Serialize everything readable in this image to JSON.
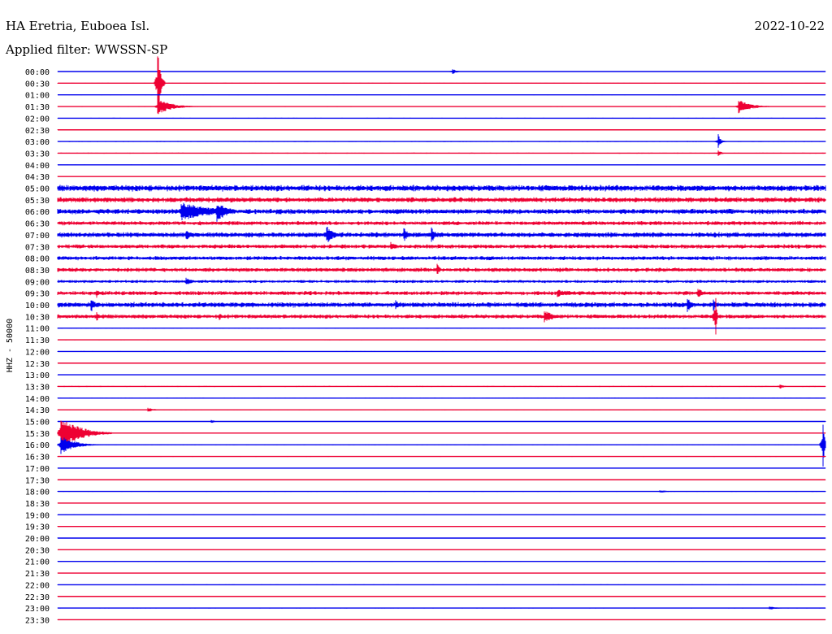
{
  "header": {
    "station": "HA Eretria, Euboea Isl.",
    "date": "2022-10-22",
    "filter_label": "Applied filter: WWSSN-SP"
  },
  "chart_data": {
    "type": "line",
    "title": "HA Eretria, Euboea Isl.",
    "subtitle": "Applied filter: WWSSN-SP",
    "ylabel": "HHZ - 50000",
    "row_labels": [
      "00:00",
      "00:30",
      "01:00",
      "01:30",
      "02:00",
      "02:30",
      "03:00",
      "03:30",
      "04:00",
      "04:30",
      "05:00",
      "05:30",
      "06:00",
      "06:30",
      "07:00",
      "07:30",
      "08:00",
      "08:30",
      "09:00",
      "09:30",
      "10:00",
      "10:30",
      "11:00",
      "11:30",
      "12:00",
      "12:30",
      "13:00",
      "13:30",
      "14:00",
      "14:30",
      "15:00",
      "15:30",
      "16:00",
      "16:30",
      "17:00",
      "17:30",
      "18:00",
      "18:30",
      "19:00",
      "19:30",
      "20:00",
      "20:30",
      "21:00",
      "21:30",
      "22:00",
      "22:30",
      "23:00",
      "23:30"
    ],
    "row_minutes": 30,
    "trace_colors": [
      "#0000ee",
      "#ee0033"
    ],
    "row_noise": [
      0.3,
      0.4,
      0.3,
      0.4,
      0.4,
      0.4,
      0.5,
      0.5,
      0.3,
      0.3,
      3.0,
      2.5,
      2.5,
      2.0,
      2.5,
      2.0,
      2.0,
      2.0,
      1.5,
      2.0,
      2.5,
      2.0,
      0.4,
      0.4,
      0.4,
      0.3,
      0.3,
      0.5,
      0.4,
      0.4,
      0.4,
      0.3,
      0.4,
      0.4,
      0.3,
      0.3,
      0.4,
      0.3,
      0.3,
      0.3,
      0.4,
      0.3,
      0.3,
      0.3,
      0.4,
      0.3,
      0.4,
      0.3
    ],
    "events": [
      {
        "row": 0,
        "minute": 15.4,
        "amplitude": 4,
        "duration_min": 0.5
      },
      {
        "row": 1,
        "minute": 3.9,
        "amplitude": 45,
        "duration_min": 0.3
      },
      {
        "row": 3,
        "minute": 3.9,
        "amplitude": 10,
        "duration_min": 1.5
      },
      {
        "row": 3,
        "minute": 26.6,
        "amplitude": 9,
        "duration_min": 1.3
      },
      {
        "row": 6,
        "minute": 25.8,
        "amplitude": 10,
        "duration_min": 0.3
      },
      {
        "row": 7,
        "minute": 25.8,
        "amplitude": 4,
        "duration_min": 0.4
      },
      {
        "row": 12,
        "minute": 4.8,
        "amplitude": 12,
        "duration_min": 3.5
      },
      {
        "row": 12,
        "minute": 6.2,
        "amplitude": 14,
        "duration_min": 1.2
      },
      {
        "row": 14,
        "minute": 5.0,
        "amplitude": 8,
        "duration_min": 0.6
      },
      {
        "row": 14,
        "minute": 10.5,
        "amplitude": 12,
        "duration_min": 0.8
      },
      {
        "row": 14,
        "minute": 13.5,
        "amplitude": 10,
        "duration_min": 0.6
      },
      {
        "row": 14,
        "minute": 14.6,
        "amplitude": 10,
        "duration_min": 0.5
      },
      {
        "row": 15,
        "minute": 13.0,
        "amplitude": 6,
        "duration_min": 0.6
      },
      {
        "row": 17,
        "minute": 14.8,
        "amplitude": 10,
        "duration_min": 0.3
      },
      {
        "row": 18,
        "minute": 5.0,
        "amplitude": 5,
        "duration_min": 0.8
      },
      {
        "row": 19,
        "minute": 1.5,
        "amplitude": 8,
        "duration_min": 0.3
      },
      {
        "row": 19,
        "minute": 19.5,
        "amplitude": 5,
        "duration_min": 1.5
      },
      {
        "row": 19,
        "minute": 25.0,
        "amplitude": 8,
        "duration_min": 0.5
      },
      {
        "row": 20,
        "minute": 1.3,
        "amplitude": 10,
        "duration_min": 0.4
      },
      {
        "row": 20,
        "minute": 13.2,
        "amplitude": 6,
        "duration_min": 0.5
      },
      {
        "row": 20,
        "minute": 24.6,
        "amplitude": 12,
        "duration_min": 0.4
      },
      {
        "row": 20,
        "minute": 25.6,
        "amplitude": 9,
        "duration_min": 0.4
      },
      {
        "row": 21,
        "minute": 1.5,
        "amplitude": 8,
        "duration_min": 0.3
      },
      {
        "row": 21,
        "minute": 6.3,
        "amplitude": 6,
        "duration_min": 0.3
      },
      {
        "row": 21,
        "minute": 19.0,
        "amplitude": 8,
        "duration_min": 1.2
      },
      {
        "row": 21,
        "minute": 25.7,
        "amplitude": 45,
        "duration_min": 0.1
      },
      {
        "row": 27,
        "minute": 28.2,
        "amplitude": 4,
        "duration_min": 0.4
      },
      {
        "row": 29,
        "minute": 3.5,
        "amplitude": 3,
        "duration_min": 0.7
      },
      {
        "row": 30,
        "minute": 6.0,
        "amplitude": 3,
        "duration_min": 0.3
      },
      {
        "row": 31,
        "minute": 0.1,
        "amplitude": 22,
        "duration_min": 2.0
      },
      {
        "row": 32,
        "minute": 0.1,
        "amplitude": 12,
        "duration_min": 1.5
      },
      {
        "row": 32,
        "minute": 29.9,
        "amplitude": 40,
        "duration_min": 0.15
      },
      {
        "row": 36,
        "minute": 23.5,
        "amplitude": 2,
        "duration_min": 1.0
      },
      {
        "row": 46,
        "minute": 27.8,
        "amplitude": 2,
        "duration_min": 1.0
      }
    ]
  }
}
